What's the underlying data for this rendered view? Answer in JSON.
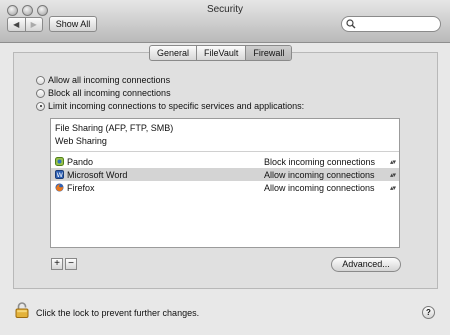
{
  "window": {
    "title": "Security"
  },
  "toolbar": {
    "back_glyph": "◀",
    "forward_glyph": "▶",
    "show_all_label": "Show All",
    "search_placeholder": ""
  },
  "tabs": [
    {
      "label": "General",
      "active": false
    },
    {
      "label": "FileVault",
      "active": false
    },
    {
      "label": "Firewall",
      "active": true
    }
  ],
  "firewall": {
    "options": [
      {
        "label": "Allow all incoming connections",
        "selected": false
      },
      {
        "label": "Block all incoming connections",
        "selected": false
      },
      {
        "label": "Limit incoming connections to specific services and applications:",
        "selected": true
      }
    ],
    "services": [
      "File Sharing (AFP, FTP, SMB)",
      "Web Sharing"
    ],
    "apps": [
      {
        "name": "Pando",
        "status": "Block incoming connections",
        "icon": "pando-icon",
        "selected": false
      },
      {
        "name": "Microsoft Word",
        "status": "Allow incoming connections",
        "icon": "word-icon",
        "selected": true
      },
      {
        "name": "Firefox",
        "status": "Allow incoming connections",
        "icon": "firefox-icon",
        "selected": false
      }
    ],
    "add_label": "+",
    "remove_label": "−",
    "advanced_label": "Advanced..."
  },
  "footer": {
    "lock_message": "Click the lock to prevent further changes.",
    "help_label": "?"
  }
}
